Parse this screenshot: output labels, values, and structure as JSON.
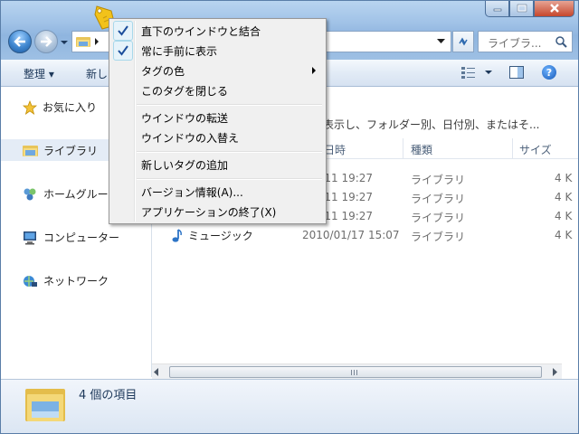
{
  "window": {
    "caption_buttons": {
      "minimize": "minimize-icon",
      "maximize": "maximize-icon",
      "close": "close-icon"
    }
  },
  "address_bar": {
    "search_placeholder": "ライブラ..."
  },
  "toolbar": {
    "organize_label": "整理 ▾",
    "new_label": "新し"
  },
  "nav_pane": {
    "favorites": "お気に入り",
    "libraries": "ライブラリ",
    "homegroup": "ホームグルー",
    "computer": "コンピューター",
    "network": "ネットワーク"
  },
  "content": {
    "header_subtitle": "表示し、フォルダー別、日付別、またはそ...",
    "columns": {
      "date": "日時",
      "type": "種類",
      "size": "サイズ"
    },
    "rows": [
      {
        "name": "",
        "date": "/01/11 19:27",
        "type": "ライブラリ",
        "size": "4 K"
      },
      {
        "name": "",
        "date": "/01/11 19:27",
        "type": "ライブラリ",
        "size": "4 K"
      },
      {
        "name": "",
        "date": "/01/11 19:27",
        "type": "ライブラリ",
        "size": "4 K"
      },
      {
        "name": "ミュージック",
        "date": "2010/01/17 15:07",
        "type": "ライブラリ",
        "size": "4 K"
      }
    ]
  },
  "details_pane": {
    "item_count": "4 個の項目"
  },
  "context_menu": {
    "items": [
      {
        "label": "直下のウインドウと結合",
        "checked": true
      },
      {
        "label": "常に手前に表示",
        "checked": true
      },
      {
        "label": "タグの色",
        "submenu": true
      },
      {
        "label": "このタグを閉じる"
      },
      {
        "label": "ウインドウの転送"
      },
      {
        "label": "ウインドウの入替え"
      },
      {
        "label": "新しいタグの追加"
      },
      {
        "label": "バージョン情報(A)..."
      },
      {
        "label": "アプリケーションの終了(X)"
      }
    ]
  },
  "colors": {
    "accent": "#3f86cf",
    "tag_yellow": "#f2c21a",
    "menu_bg": "#f0f0f0"
  }
}
